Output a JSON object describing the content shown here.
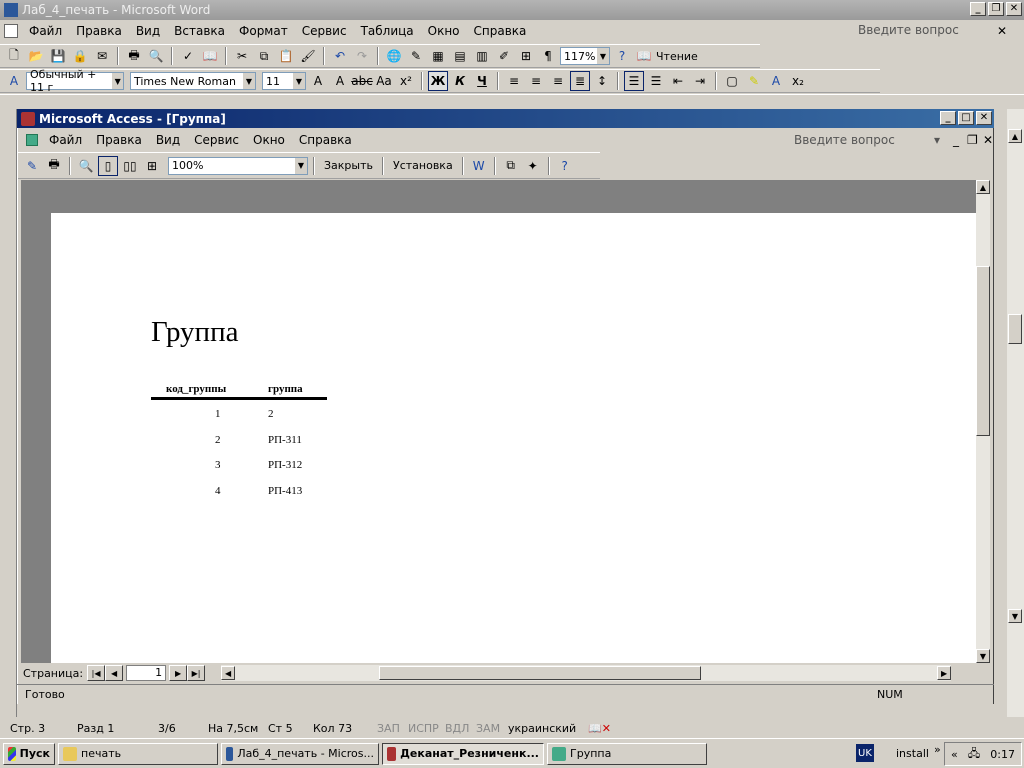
{
  "word": {
    "title": "Лаб_4_печать - Microsoft Word",
    "menu": [
      "Файл",
      "Правка",
      "Вид",
      "Вставка",
      "Формат",
      "Сервис",
      "Таблица",
      "Окно",
      "Справка"
    ],
    "ask_placeholder": "Введите вопрос",
    "zoom": "117%",
    "reading": "Чтение",
    "style": "Обычный + 11 г",
    "font": "Times New Roman",
    "size": "11",
    "bold": "Ж",
    "italic": "К",
    "underline": "Ч",
    "status": {
      "page": "Стр. 3",
      "section": "Разд 1",
      "pages": "3/6",
      "at": "На 7,5см",
      "line": "Ст 5",
      "col": "Кол 73",
      "rec": "ЗАП",
      "trk": "ИСПР",
      "ext": "ВДЛ",
      "ovr": "ЗАМ",
      "lang": "украинский"
    }
  },
  "access": {
    "title": "Microsoft Access - [Группа]",
    "menu": [
      "Файл",
      "Правка",
      "Вид",
      "Сервис",
      "Окно",
      "Справка"
    ],
    "ask_placeholder": "Введите вопрос",
    "zoom": "100%",
    "close_label": "Закрыть",
    "setup_label": "Установка",
    "page_label": "Страница:",
    "page_value": "1",
    "status_ready": "Готово",
    "status_num": "NUM"
  },
  "report": {
    "title": "Группа",
    "columns": [
      "код_группы",
      "группа"
    ],
    "rows": [
      {
        "code": "1",
        "group": "2"
      },
      {
        "code": "2",
        "group": "РП-311"
      },
      {
        "code": "3",
        "group": "РП-312"
      },
      {
        "code": "4",
        "group": "РП-413"
      }
    ]
  },
  "taskbar": {
    "start": "Пуск",
    "tasks": [
      "печать",
      "Лаб_4_печать - Micros...",
      "Деканат_Резниченк...",
      "Группа"
    ],
    "lang": "UK",
    "install": "install",
    "time": "0:17"
  }
}
